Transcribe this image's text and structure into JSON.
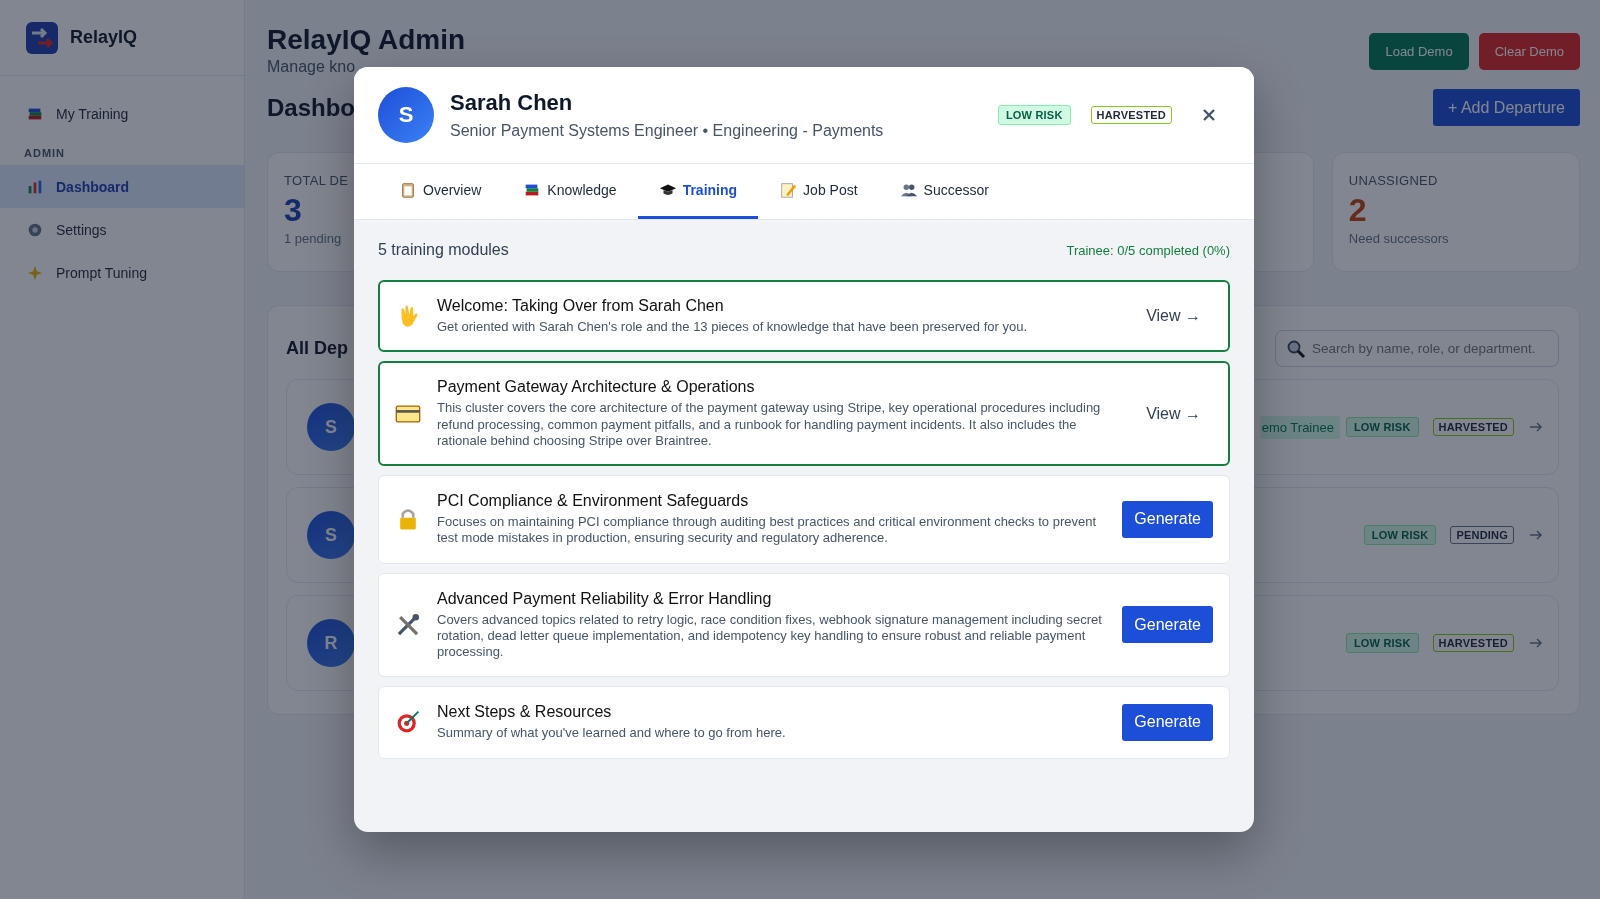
{
  "sidebar": {
    "brand": "RelayIQ",
    "items": [
      {
        "label": "My Training",
        "selected": false
      }
    ],
    "section": "ADMIN",
    "admin_items": [
      {
        "label": "Dashboard",
        "selected": true
      },
      {
        "label": "Settings",
        "selected": false
      },
      {
        "label": "Prompt Tuning",
        "selected": false
      }
    ]
  },
  "header": {
    "title": "RelayIQ Admin",
    "subtitle": "Manage kno",
    "buttons": [
      "Load Demo",
      "Clear Demo"
    ]
  },
  "dashboard": {
    "title": "Dashbo",
    "add_button": "+ Add Departure",
    "stats": [
      {
        "label": "TOTAL DE",
        "value": "3",
        "note": "1 pending"
      },
      {
        "label": "UNASSIGNED",
        "value": "2",
        "note": "Need successors"
      }
    ]
  },
  "departures": {
    "title": "All Dep",
    "search": {
      "placeholder": "Search by name, role, or department."
    },
    "rows": [
      {
        "initial": "S",
        "badges": [
          {
            "label": "emo Trainee",
            "kind": "trainee"
          },
          {
            "label": "LOW RISK",
            "kind": "risk"
          },
          {
            "label": "HARVESTED",
            "kind": "harvested"
          }
        ]
      },
      {
        "initial": "S",
        "badges": [
          {
            "label": "LOW RISK",
            "kind": "risk"
          },
          {
            "label": "PENDING",
            "kind": "pending"
          }
        ]
      },
      {
        "initial": "R",
        "badges": [
          {
            "label": "LOW RISK",
            "kind": "risk"
          },
          {
            "label": "HARVESTED",
            "kind": "harvested"
          }
        ]
      }
    ]
  },
  "modal": {
    "initial": "S",
    "name": "Sarah Chen",
    "role": "Senior Payment Systems Engineer • Engineering - Payments",
    "badges": [
      {
        "label": "LOW RISK",
        "kind": "risk"
      },
      {
        "label": "HARVESTED",
        "kind": "harvested"
      }
    ],
    "tabs": [
      {
        "label": "Overview",
        "selected": false
      },
      {
        "label": "Knowledge",
        "selected": false
      },
      {
        "label": "Training",
        "selected": true
      },
      {
        "label": "Job Post",
        "selected": false
      },
      {
        "label": "Successor",
        "selected": false
      }
    ],
    "summary": "5 training modules",
    "progress": "Trainee: 0/5 completed (0%)",
    "modules": [
      {
        "title": "Welcome: Taking Over from Sarah Chen",
        "description": "Get oriented with Sarah Chen's role and the 13 pieces of knowledge that have been preserved for you.",
        "generated": true,
        "action": "View →"
      },
      {
        "title": "Payment Gateway Architecture & Operations",
        "description": "This cluster covers the core architecture of the payment gateway using Stripe, key operational procedures including refund processing, common payment pitfalls, and a runbook for handling payment incidents. It also includes the rationale behind choosing Stripe over Braintree.",
        "generated": true,
        "action": "View →"
      },
      {
        "title": "PCI Compliance & Environment Safeguards",
        "description": "Focuses on maintaining PCI compliance through auditing best practices and critical environment checks to prevent test mode mistakes in production, ensuring security and regulatory adherence.",
        "generated": false,
        "action": "Generate"
      },
      {
        "title": "Advanced Payment Reliability & Error Handling",
        "description": "Covers advanced topics related to retry logic, race condition fixes, webhook signature management including secret rotation, dead letter queue implementation, and idempotency key handling to ensure robust and reliable payment processing.",
        "generated": false,
        "action": "Generate"
      },
      {
        "title": "Next Steps & Resources",
        "description": "Summary of what you've learned and where to go from here.",
        "generated": false,
        "action": "Generate"
      }
    ]
  }
}
